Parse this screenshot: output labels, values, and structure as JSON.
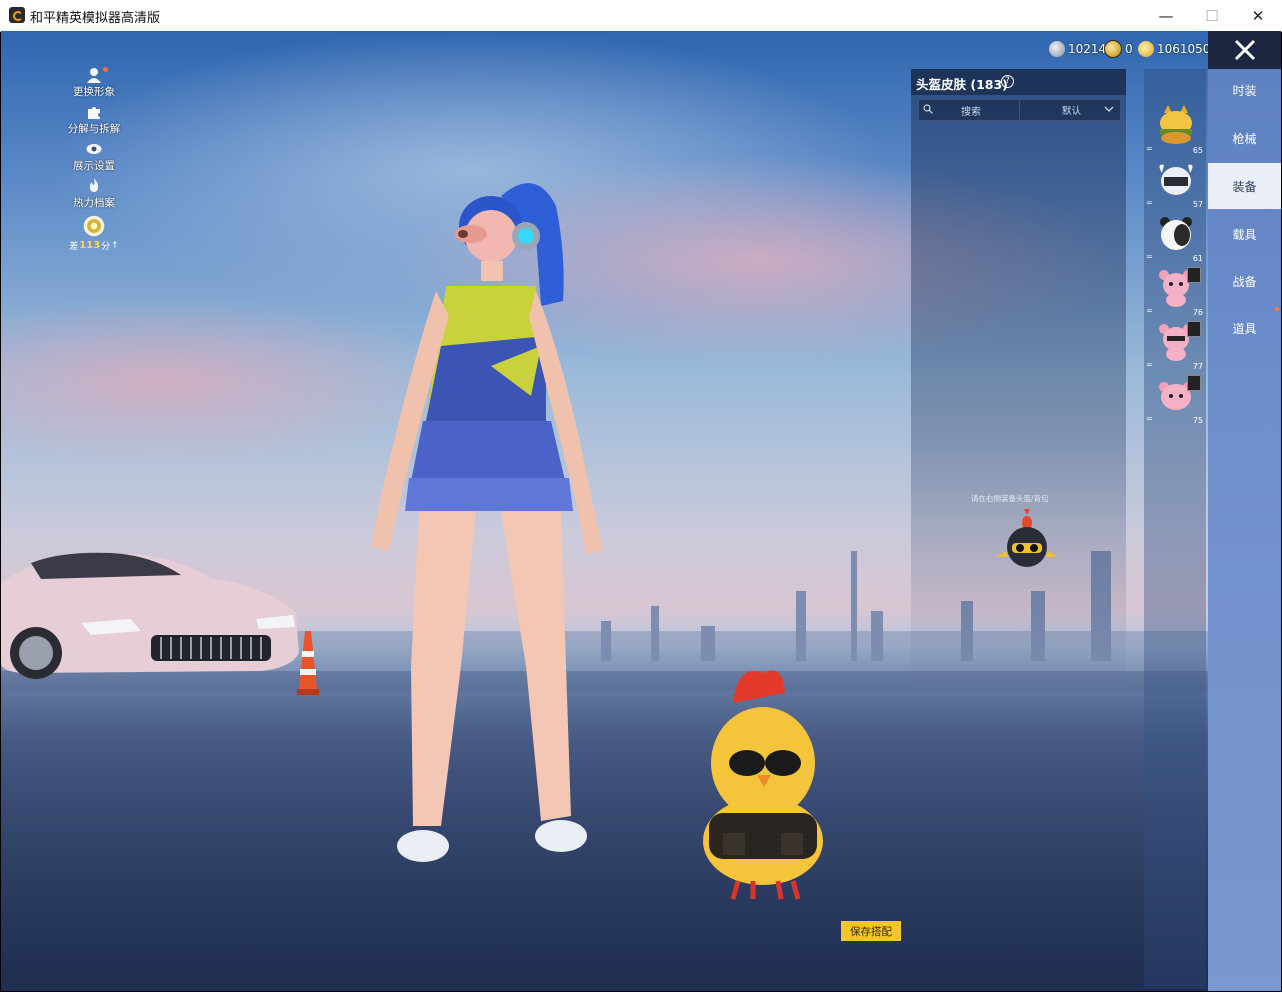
{
  "window": {
    "title": "和平精英模拟器高清版",
    "minimize_symbol": "—",
    "maximize_symbol": "☐",
    "close_symbol": "✕"
  },
  "left_menu": [
    {
      "label": "更换形象",
      "icon": "avatar-icon",
      "dot": true
    },
    {
      "label": "分解与拆解",
      "icon": "puzzle-icon"
    },
    {
      "label": "展示设置",
      "icon": "eye-icon"
    },
    {
      "label": "热力档案",
      "icon": "flame-icon"
    }
  ],
  "heat_badge": {
    "prefix": "差",
    "value": "113",
    "suffix": "分"
  },
  "currency": [
    {
      "icon": "silver-coin-icon",
      "value": "10214",
      "color": "#b8bcc8"
    },
    {
      "icon": "ticket-icon",
      "value": "0",
      "color": "#e0b040"
    },
    {
      "icon": "gold-coin-icon",
      "value": "1061050",
      "color": "#f2c640"
    }
  ],
  "skin_panel": {
    "title": "头盔皮肤 (183)",
    "help": "?",
    "search_label": "搜索",
    "sort_label": "默认",
    "hint": "请在右侧装备头盔/背包"
  },
  "items": [
    {
      "name": "burger-helmet",
      "count": "65",
      "dash": "="
    },
    {
      "name": "horned-helmet",
      "count": "57",
      "dash": "="
    },
    {
      "name": "panda-helmet",
      "count": "61",
      "dash": "="
    },
    {
      "name": "pink-bear-a",
      "count": "76",
      "dash": "="
    },
    {
      "name": "pink-bear-b",
      "count": "77",
      "dash": "="
    },
    {
      "name": "pink-bear-c",
      "count": "75",
      "dash": "="
    }
  ],
  "categories": [
    {
      "label": "时装",
      "active": false
    },
    {
      "label": "枪械",
      "active": false
    },
    {
      "label": "装备",
      "active": true
    },
    {
      "label": "载具",
      "active": false
    },
    {
      "label": "战备",
      "active": false
    },
    {
      "label": "道具",
      "active": false
    }
  ],
  "save_button": "保存搭配"
}
